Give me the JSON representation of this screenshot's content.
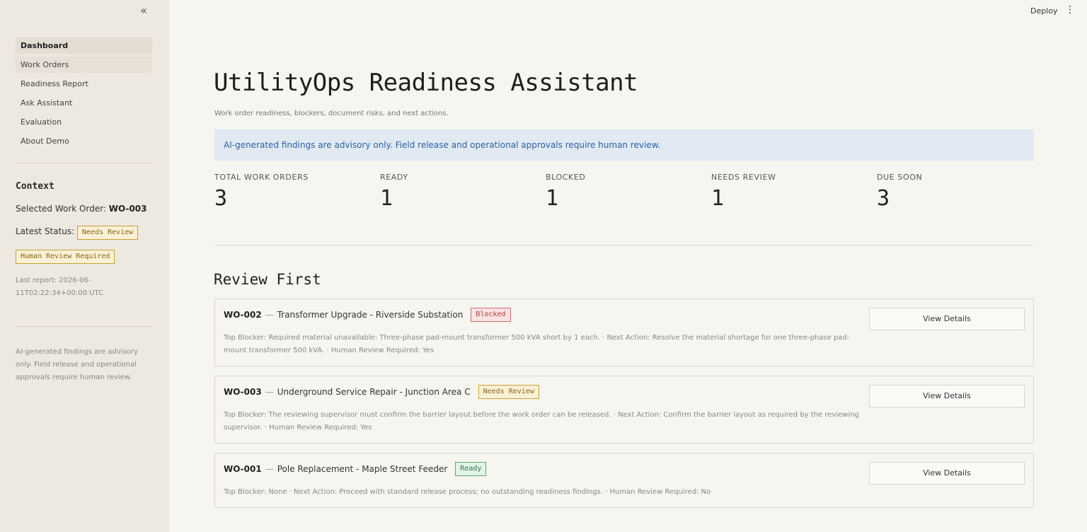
{
  "sidebar": {
    "collapse_icon": "double-chevron-left-icon",
    "nav": [
      "Dashboard",
      "Work Orders",
      "Readiness Report",
      "Ask Assistant",
      "Evaluation",
      "About Demo"
    ],
    "context_title": "Context",
    "selected_label": "Selected Work Order:",
    "selected_value": "WO-003",
    "status_label": "Latest Status:",
    "status_badge": "Needs Review",
    "human_review_badge": "Human Review Required",
    "last_report": "Last report: 2026-06-11T02:22:34+00:00 UTC",
    "disclaimer": "AI-generated findings are advisory only. Field release and operational approvals require human review."
  },
  "topbar": {
    "deploy": "Deploy",
    "menu_icon": "kebab-menu-icon"
  },
  "main": {
    "title": "UtilityOps Readiness Assistant",
    "subtitle": "Work order readiness, blockers, document risks, and next actions.",
    "info": "AI-generated findings are advisory only. Field release and operational approvals require human review.",
    "metrics": [
      {
        "label": "TOTAL WORK ORDERS",
        "value": "3"
      },
      {
        "label": "READY",
        "value": "1"
      },
      {
        "label": "BLOCKED",
        "value": "1"
      },
      {
        "label": "NEEDS REVIEW",
        "value": "1"
      },
      {
        "label": "DUE SOON",
        "value": "3"
      }
    ],
    "section_title": "Review First",
    "cards": [
      {
        "id": "WO-002",
        "dash": "—",
        "title": "Transformer Upgrade - Riverside Substation",
        "status": "Blocked",
        "body": "Top Blocker: Required material unavailable: Three-phase pad-mount transformer 500 kVA short by 1 each. · Next Action: Resolve the material shortage for one three-phase pad-mount transformer 500 kVA. · Human Review Required: Yes",
        "button": "View Details"
      },
      {
        "id": "WO-003",
        "dash": "—",
        "title": "Underground Service Repair - Junction Area C",
        "status": "Needs Review",
        "body": "Top Blocker: The reviewing supervisor must confirm the barrier layout before the work order can be released. · Next Action: Confirm the barrier layout as required by the reviewing supervisor. · Human Review Required: Yes",
        "button": "View Details"
      },
      {
        "id": "WO-001",
        "dash": "—",
        "title": "Pole Replacement - Maple Street Feeder",
        "status": "Ready",
        "body": "Top Blocker: None · Next Action: Proceed with standard release process; no outstanding readiness findings. · Human Review Required: No",
        "button": "View Details"
      }
    ]
  }
}
